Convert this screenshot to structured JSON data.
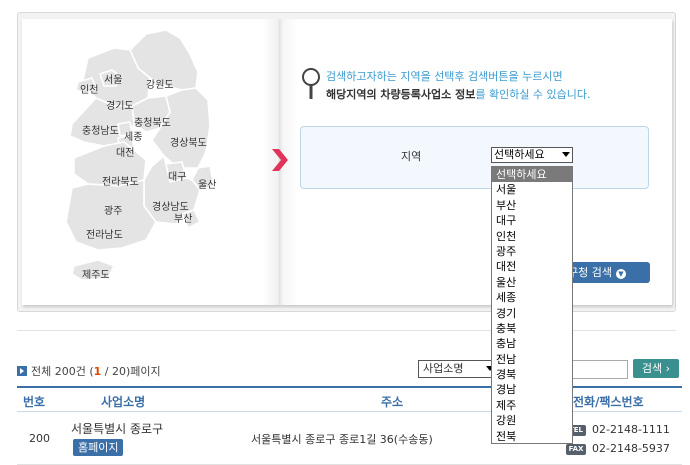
{
  "map": {
    "regions": [
      "서울",
      "인천",
      "강원도",
      "경기도",
      "충청북도",
      "충청남도",
      "세종",
      "대전",
      "경상북도",
      "대구",
      "울산",
      "전라북도",
      "경상남도",
      "부산",
      "광주",
      "전라남도",
      "제주도"
    ]
  },
  "notice": {
    "line1": "검색하고자하는 지역을 선택후 검색버튼을 누르시면",
    "line2_bold": "해당지역의 차량등록사업소 정보",
    "line2_rest": "를 확인하실 수 있습니다."
  },
  "search": {
    "region_label": "지역",
    "selected": "선택하세요",
    "options": [
      "선택하세요",
      "서울",
      "부산",
      "대구",
      "인천",
      "광주",
      "대전",
      "울산",
      "세종",
      "경기",
      "충북",
      "충남",
      "전남",
      "경북",
      "경남",
      "제주",
      "강원",
      "전북"
    ],
    "button_label": "구청 검색"
  },
  "results": {
    "total_prefix": "전체 200건 (",
    "current_page": "1",
    "total_suffix": " / 20)페이지",
    "sort_selected": "사업소명",
    "go_button": "검색",
    "columns": [
      "번호",
      "사업소명",
      "주소",
      "전화/팩스번호"
    ],
    "rows": [
      {
        "no": "200",
        "name": "서울특별시 종로구",
        "homepage": "홈페이지",
        "address": "서울특별시 종로구 종로1길 36(수송동)",
        "tel_tag": "TEL",
        "tel": "02-2148-1111",
        "fax_tag": "FAX",
        "fax": "02-2148-5937"
      }
    ]
  },
  "colors": {
    "accent": "#3b6fa8",
    "notice_blue": "#3a9bd0",
    "arrow_red": "#e0345a",
    "map_fill": "#e4e4e4",
    "page_current": "#e04a00"
  }
}
